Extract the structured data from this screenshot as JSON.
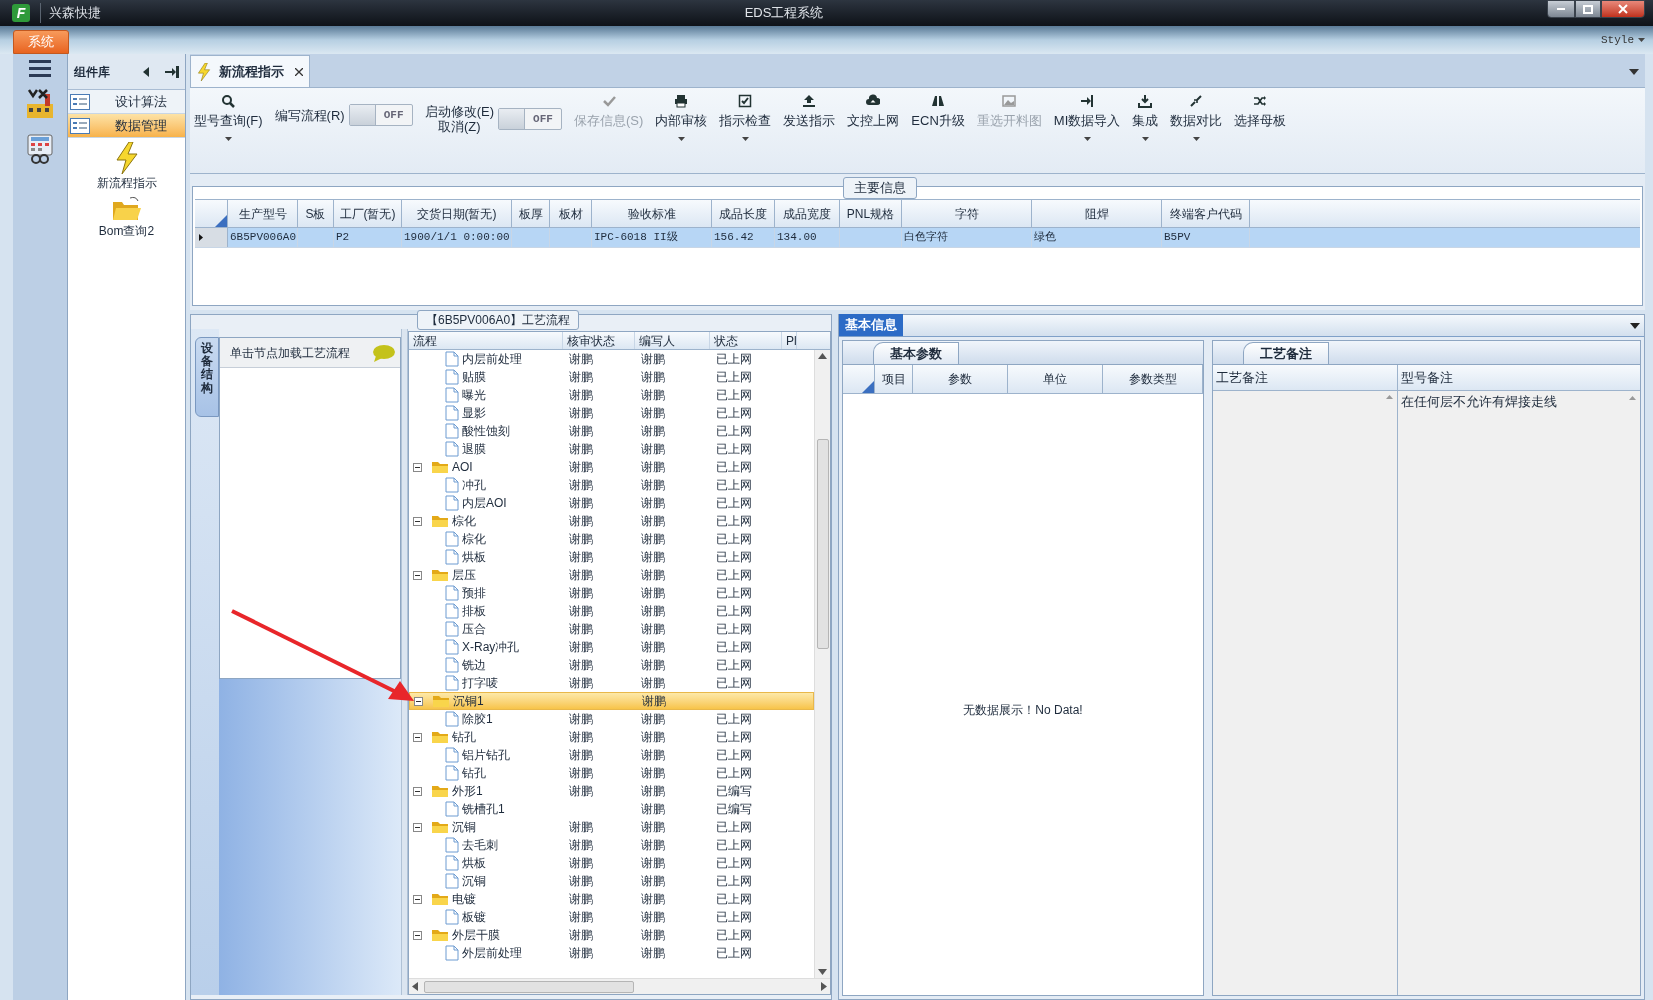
{
  "window": {
    "logo_letter": "F",
    "app_name": "兴森快捷",
    "title": "EDS工程系统"
  },
  "ribbon": {
    "tab": "系统",
    "style_menu": "Style"
  },
  "component_panel": {
    "title": "组件库",
    "items": [
      {
        "label": "设计算法",
        "selected": false
      },
      {
        "label": "数据管理",
        "selected": true
      }
    ],
    "tiles": [
      "新流程指示",
      "Bom查询2"
    ]
  },
  "document_tab": {
    "label": "新流程指示"
  },
  "toolbar": [
    {
      "kind": "button",
      "label": "型号查询(F)",
      "dropdown": true,
      "disabled": false
    },
    {
      "kind": "toggle",
      "label": "编写流程(R)",
      "switch_text": "OFF",
      "on": false
    },
    {
      "kind": "toggle",
      "label": "启动修改(E)\n取消(Z)",
      "switch_text": "OFF",
      "on": false
    },
    {
      "kind": "button",
      "label": "保存信息(S)",
      "dropdown": false,
      "disabled": true
    },
    {
      "kind": "button",
      "label": "内部审核",
      "dropdown": true,
      "disabled": false
    },
    {
      "kind": "button",
      "label": "指示检查",
      "dropdown": true,
      "disabled": false
    },
    {
      "kind": "button",
      "label": "发送指示",
      "dropdown": false,
      "disabled": false
    },
    {
      "kind": "button",
      "label": "文控上网",
      "dropdown": false,
      "disabled": false
    },
    {
      "kind": "button",
      "label": "ECN升级",
      "dropdown": false,
      "disabled": false
    },
    {
      "kind": "button",
      "label": "重选开料图",
      "dropdown": false,
      "disabled": true
    },
    {
      "kind": "button",
      "label": "MI数据导入",
      "dropdown": true,
      "disabled": false
    },
    {
      "kind": "button",
      "label": "集成",
      "dropdown": true,
      "disabled": false
    },
    {
      "kind": "button",
      "label": "数据对比",
      "dropdown": true,
      "disabled": false
    },
    {
      "kind": "button",
      "label": "选择母板",
      "dropdown": false,
      "disabled": false
    }
  ],
  "main_info": {
    "title": "主要信息",
    "columns": [
      "生产型号",
      "S板",
      "工厂(暂无)",
      "交货日期(暂无)",
      "板厚",
      "板材",
      "验收标准",
      "成品长度",
      "成品宽度",
      "PNL规格",
      "字符",
      "阻焊",
      "终端客户代码"
    ],
    "rows": [
      {
        "selected": true,
        "cells": [
          "6B5PV006A0",
          null,
          "P2",
          "1900/1/1 0:00:00",
          null,
          null,
          "IPC-6018 II级",
          "156.42",
          "134.00",
          null,
          "白色字符",
          "绿色",
          "B5PV"
        ]
      }
    ]
  },
  "process_flow": {
    "title": "【6B5PV006A0】工艺流程",
    "side_tab": "设备结构",
    "hint": "单击节点加载工艺流程",
    "columns": [
      "流程",
      "核审状态",
      "编写人",
      "状态",
      "Pl"
    ],
    "leading_children": [
      {
        "kind": "file",
        "name": "内层前处理",
        "review": "谢鹏",
        "writer": "谢鹏",
        "status": "已上网",
        "selected": false
      },
      {
        "kind": "file",
        "name": "贴膜",
        "review": "谢鹏",
        "writer": "谢鹏",
        "status": "已上网",
        "selected": false
      },
      {
        "kind": "file",
        "name": "曝光",
        "review": "谢鹏",
        "writer": "谢鹏",
        "status": "已上网",
        "selected": false
      },
      {
        "kind": "file",
        "name": "显影",
        "review": "谢鹏",
        "writer": "谢鹏",
        "status": "已上网",
        "selected": false
      },
      {
        "kind": "file",
        "name": "酸性蚀刻",
        "review": "谢鹏",
        "writer": "谢鹏",
        "status": "已上网",
        "selected": false
      },
      {
        "kind": "file",
        "name": "退膜",
        "review": "谢鹏",
        "writer": "谢鹏",
        "status": "已上网",
        "selected": false
      }
    ],
    "nodes": [
      {
        "kind": "folder",
        "name": "AOI",
        "review": "谢鹏",
        "writer": "谢鹏",
        "status": "已上网",
        "selected": false,
        "expanded": true,
        "children": [
          {
            "kind": "file",
            "name": "冲孔",
            "review": "谢鹏",
            "writer": "谢鹏",
            "status": "已上网",
            "selected": false
          },
          {
            "kind": "file",
            "name": "内层AOI",
            "review": "谢鹏",
            "writer": "谢鹏",
            "status": "已上网",
            "selected": false
          }
        ]
      },
      {
        "kind": "folder",
        "name": "棕化",
        "review": "谢鹏",
        "writer": "谢鹏",
        "status": "已上网",
        "selected": false,
        "expanded": true,
        "children": [
          {
            "kind": "file",
            "name": "棕化",
            "review": "谢鹏",
            "writer": "谢鹏",
            "status": "已上网",
            "selected": false
          },
          {
            "kind": "file",
            "name": "烘板",
            "review": "谢鹏",
            "writer": "谢鹏",
            "status": "已上网",
            "selected": false
          }
        ]
      },
      {
        "kind": "folder",
        "name": "层压",
        "review": "谢鹏",
        "writer": "谢鹏",
        "status": "已上网",
        "selected": false,
        "expanded": true,
        "children": [
          {
            "kind": "file",
            "name": "预排",
            "review": "谢鹏",
            "writer": "谢鹏",
            "status": "已上网",
            "selected": false
          },
          {
            "kind": "file",
            "name": "排板",
            "review": "谢鹏",
            "writer": "谢鹏",
            "status": "已上网",
            "selected": false
          },
          {
            "kind": "file",
            "name": "压合",
            "review": "谢鹏",
            "writer": "谢鹏",
            "status": "已上网",
            "selected": false
          },
          {
            "kind": "file",
            "name": "X-Ray冲孔",
            "review": "谢鹏",
            "writer": "谢鹏",
            "status": "已上网",
            "selected": false
          },
          {
            "kind": "file",
            "name": "铣边",
            "review": "谢鹏",
            "writer": "谢鹏",
            "status": "已上网",
            "selected": false
          },
          {
            "kind": "file",
            "name": "打字唛",
            "review": "谢鹏",
            "writer": "谢鹏",
            "status": "已上网",
            "selected": false
          }
        ]
      },
      {
        "kind": "folder",
        "name": "沉铜1",
        "writer": "谢鹏",
        "selected": true,
        "expanded": true,
        "children": [
          {
            "kind": "file",
            "name": "除胶1",
            "review": "谢鹏",
            "writer": "谢鹏",
            "status": "已上网",
            "selected": false
          }
        ]
      },
      {
        "kind": "folder",
        "name": "钻孔",
        "review": "谢鹏",
        "writer": "谢鹏",
        "status": "已上网",
        "selected": false,
        "expanded": true,
        "children": [
          {
            "kind": "file",
            "name": "铝片钻孔",
            "review": "谢鹏",
            "writer": "谢鹏",
            "status": "已上网",
            "selected": false
          },
          {
            "kind": "file",
            "name": "钻孔",
            "review": "谢鹏",
            "writer": "谢鹏",
            "status": "已上网",
            "selected": false
          }
        ]
      },
      {
        "kind": "folder",
        "name": "外形1",
        "review": "谢鹏",
        "writer": "谢鹏",
        "status": "已编写",
        "selected": false,
        "expanded": true,
        "children": [
          {
            "kind": "file",
            "name": "铣槽孔1",
            "writer": "谢鹏",
            "status": "已编写",
            "selected": false
          }
        ]
      },
      {
        "kind": "folder",
        "name": "沉铜",
        "review": "谢鹏",
        "writer": "谢鹏",
        "status": "已上网",
        "selected": false,
        "expanded": true,
        "children": [
          {
            "kind": "file",
            "name": "去毛刺",
            "review": "谢鹏",
            "writer": "谢鹏",
            "status": "已上网",
            "selected": false
          },
          {
            "kind": "file",
            "name": "烘板",
            "review": "谢鹏",
            "writer": "谢鹏",
            "status": "已上网",
            "selected": false
          },
          {
            "kind": "file",
            "name": "沉铜",
            "review": "谢鹏",
            "writer": "谢鹏",
            "status": "已上网",
            "selected": false
          }
        ]
      },
      {
        "kind": "folder",
        "name": "电镀",
        "review": "谢鹏",
        "writer": "谢鹏",
        "status": "已上网",
        "selected": false,
        "expanded": true,
        "children": [
          {
            "kind": "file",
            "name": "板镀",
            "review": "谢鹏",
            "writer": "谢鹏",
            "status": "已上网",
            "selected": false
          }
        ]
      },
      {
        "kind": "folder",
        "name": "外层干膜",
        "review": "谢鹏",
        "writer": "谢鹏",
        "status": "已上网",
        "selected": false,
        "expanded": true,
        "children": [
          {
            "kind": "file",
            "name": "外层前处理",
            "review": "谢鹏",
            "writer": "谢鹏",
            "status": "已上网",
            "selected": false
          }
        ]
      }
    ]
  },
  "basic_info": {
    "tab": "基本信息",
    "params": {
      "tab": "基本参数",
      "columns": [
        "项目",
        "参数",
        "单位",
        "参数类型"
      ],
      "empty_text": "无数据展示！No Data!"
    },
    "notes": {
      "tab": "工艺备注",
      "columns": [
        "工艺备注",
        "型号备注"
      ],
      "model_note": "在任何层不允许有焊接走线"
    }
  }
}
